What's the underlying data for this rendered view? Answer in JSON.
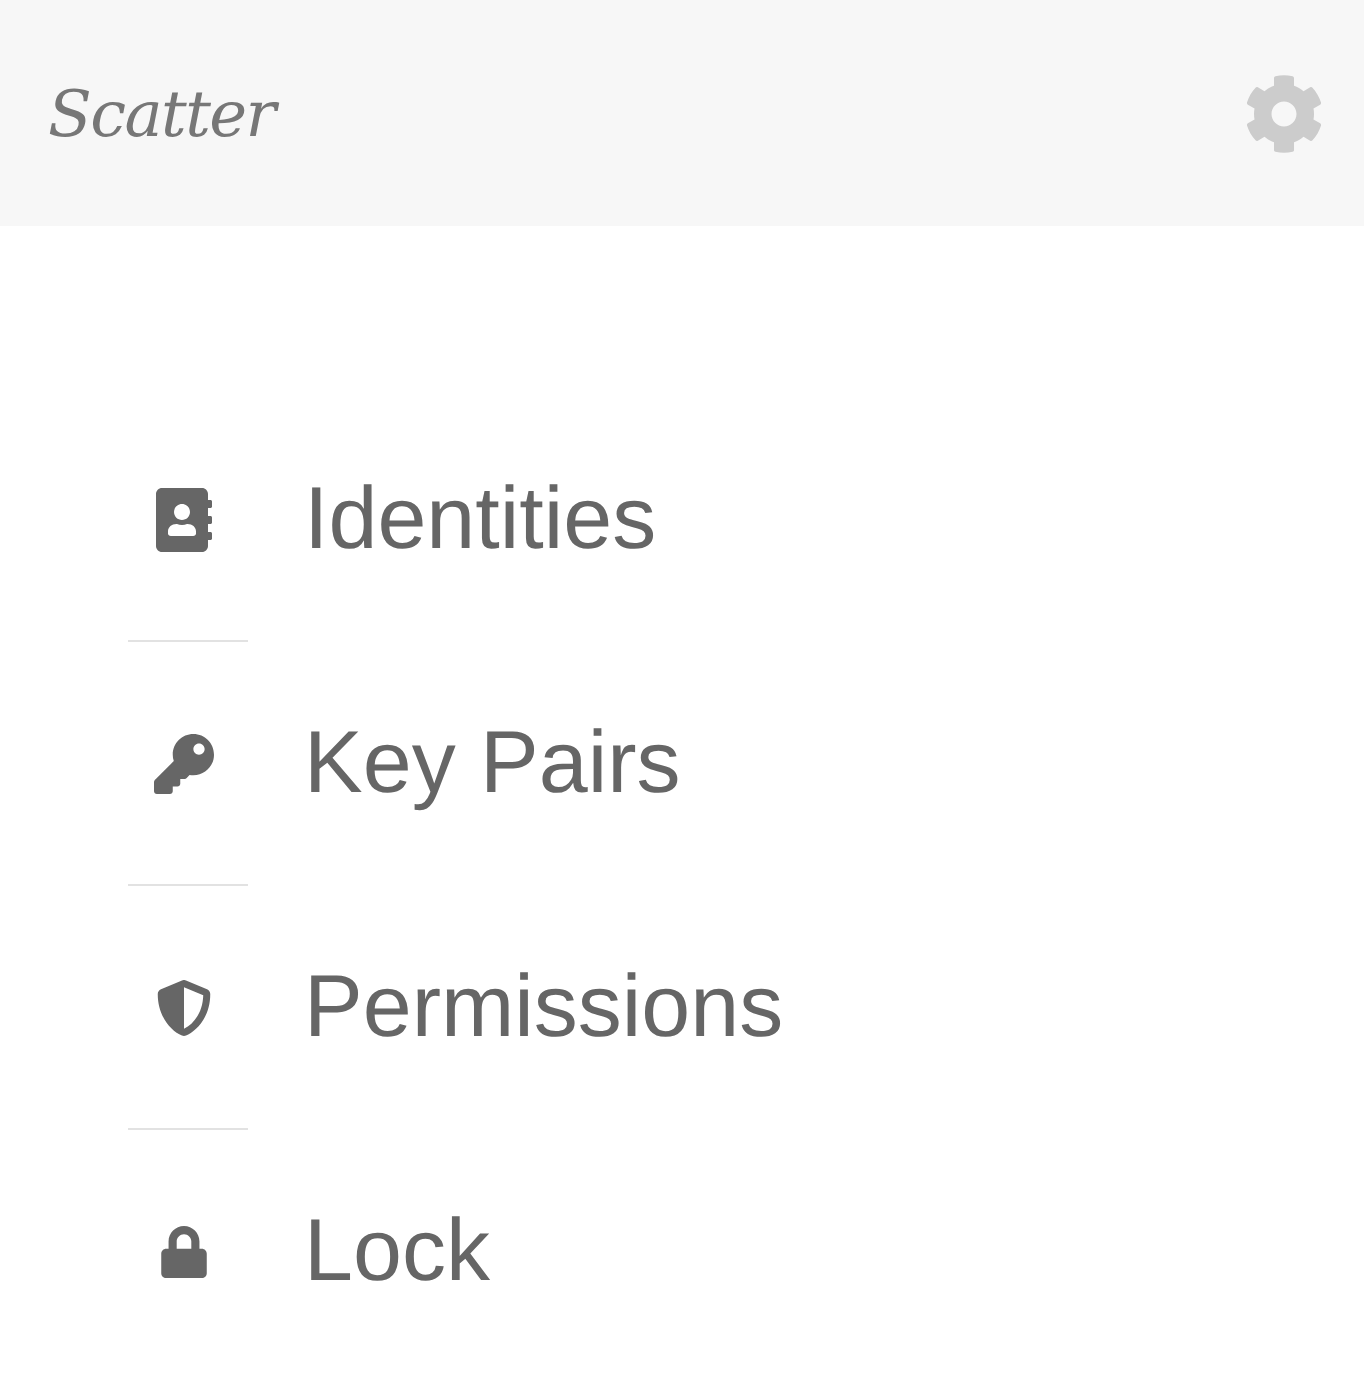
{
  "header": {
    "logo": "Scatter"
  },
  "menu": [
    {
      "label": "Identities"
    },
    {
      "label": "Key Pairs"
    },
    {
      "label": "Permissions"
    },
    {
      "label": "Lock"
    }
  ]
}
